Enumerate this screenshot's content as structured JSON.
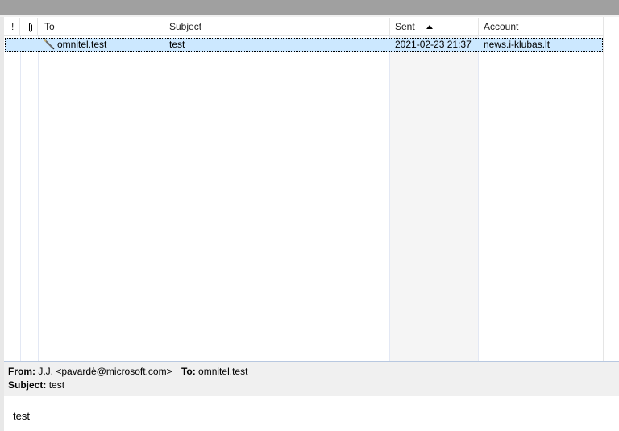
{
  "columns": {
    "priority": "!",
    "attachment": "📎",
    "to": "To",
    "subject": "Subject",
    "sent": "Sent",
    "account": "Account"
  },
  "sort": {
    "column": "Sent",
    "direction": "ascending"
  },
  "messages": [
    {
      "to": "omnitel.test",
      "subject": "test",
      "sent": "2021-02-23 21:37",
      "account": "news.i-klubas.lt",
      "icon": "pencil-icon",
      "selected": true
    }
  ],
  "preview": {
    "from_label": "From:",
    "from_value": "J.J. <pavardė@microsoft.com>",
    "to_label": "To:",
    "to_value": "omnitel.test",
    "subject_label": "Subject:",
    "subject_value": "test",
    "body": "test"
  },
  "colors": {
    "selection": "#cce8ff",
    "sorted_column": "#f5f5f5",
    "preview_header": "#f0f0f0"
  }
}
